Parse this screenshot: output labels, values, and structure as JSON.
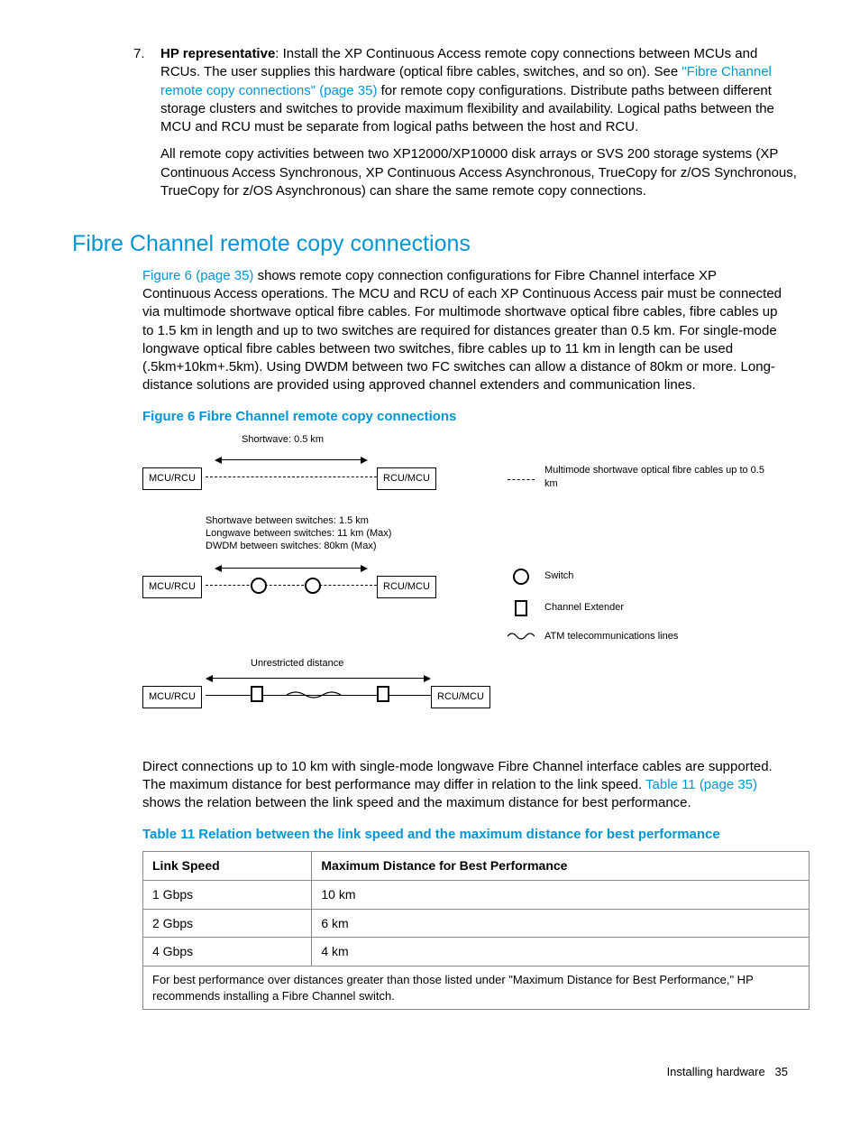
{
  "listItem": {
    "number": "7.",
    "label": "HP representative",
    "p1a": ": Install the XP Continuous Access remote copy connections between MCUs and RCUs. The user supplies this hardware (optical fibre cables, switches, and so on). See ",
    "link": "\"Fibre Channel remote copy connections\" (page 35)",
    "p1b": " for remote copy configurations. Distribute paths between different storage clusters and switches to provide maximum flexibility and availability. Logical paths between the MCU and RCU must be separate from logical paths between the host and RCU.",
    "p2": "All remote copy activities between two XP12000/XP10000 disk arrays or SVS 200 storage systems (XP Continuous Access Synchronous, XP Continuous Access Asynchronous, TrueCopy for z/OS Synchronous, TrueCopy for z/OS Asynchronous) can share the same remote copy connections."
  },
  "section": {
    "heading": "Fibre Channel remote copy connections",
    "p1_link": "Figure 6 (page 35)",
    "p1": " shows remote copy connection configurations for Fibre Channel interface XP Continuous Access operations. The MCU and RCU of each XP Continuous Access pair must be connected via multimode shortwave optical fibre cables. For multimode shortwave optical fibre cables, fibre cables up to 1.5 km in length and up to two switches are required for distances greater than 0.5 km. For single-mode longwave optical fibre cables between two switches, fibre cables up to 11 km in length can be used (.5km+10km+.5km). Using DWDM between two FC switches can allow a distance of 80km or more. Long-distance solutions are provided using approved channel extenders and communication lines."
  },
  "figure": {
    "title": "Figure 6 Fibre Channel remote copy connections",
    "shortwave": "Shortwave: 0.5 km",
    "mcurcu": "MCU/RCU",
    "rcumcu": "RCU/MCU",
    "legend1": "Multimode shortwave optical fibre cables up to 0.5 km",
    "between1": "Shortwave between switches:  1.5 km",
    "between2": "Longwave between switches: 11 km (Max)",
    "between3": "DWDM between switches: 80km (Max)",
    "switch": "Switch",
    "extender": "Channel Extender",
    "atm": "ATM telecommunications lines",
    "unrestricted": "Unrestricted distance"
  },
  "para2": {
    "text1": "Direct connections up to 10 km with single-mode longwave Fibre Channel interface cables are supported. The maximum distance for best performance may differ in relation to the link speed. ",
    "link": "Table 11 (page 35)",
    "text2": " shows the relation between the link speed and the maximum distance for best performance."
  },
  "table": {
    "title": "Table 11 Relation between the link speed and the maximum distance for best performance",
    "h1": "Link Speed",
    "h2": "Maximum Distance for Best Performance",
    "rows": [
      {
        "c1": "1 Gbps",
        "c2": "10 km"
      },
      {
        "c1": "2 Gbps",
        "c2": "6 km"
      },
      {
        "c1": "4 Gbps",
        "c2": "4 km"
      }
    ],
    "note": "For best performance over distances greater than those listed under \"Maximum Distance for Best Performance,\" HP recommends installing a Fibre Channel switch."
  },
  "footer": {
    "text": "Installing hardware",
    "page": "35"
  }
}
